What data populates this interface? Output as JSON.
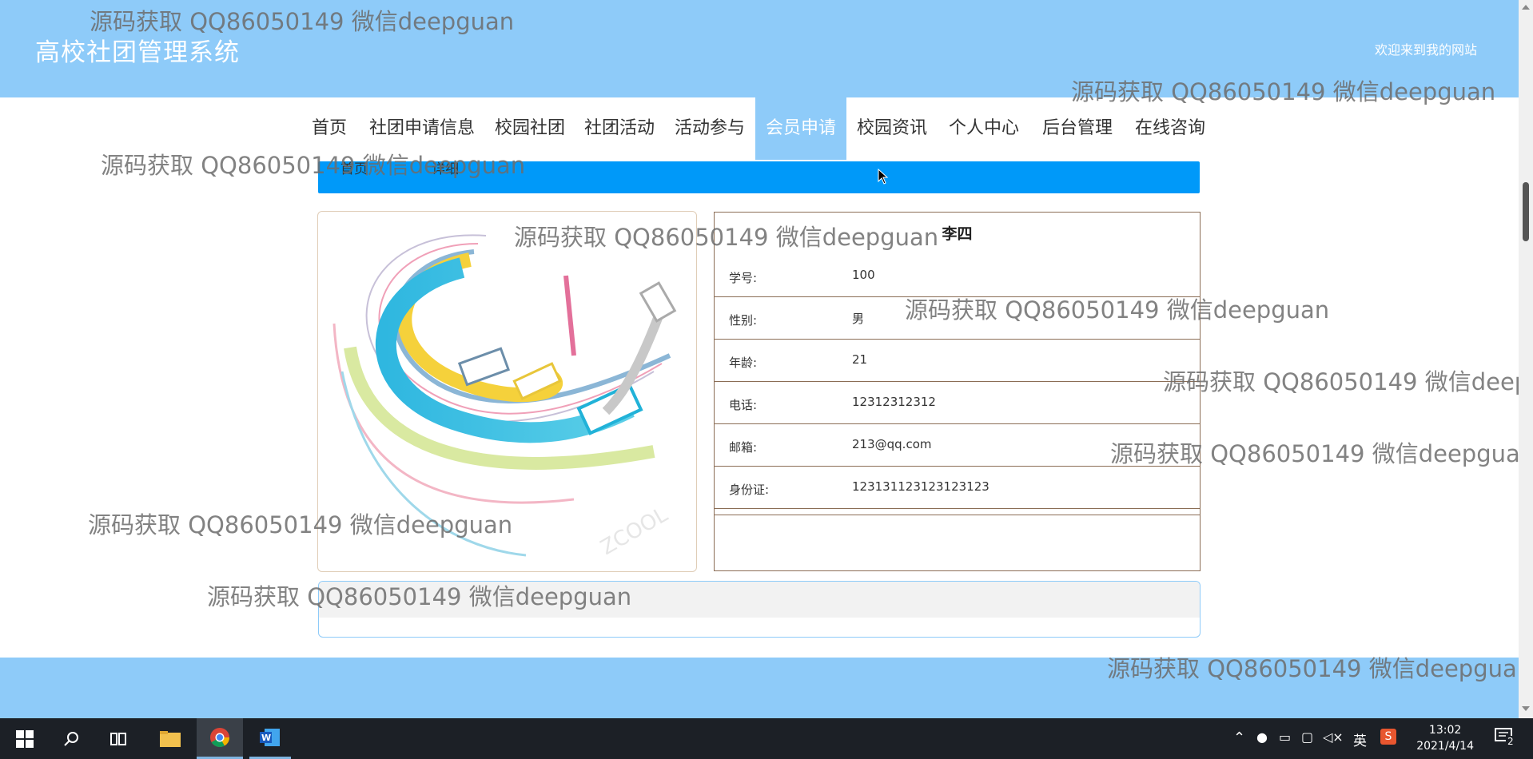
{
  "header": {
    "site_title": "高校社团管理系统",
    "welcome": "欢迎来到我的网站"
  },
  "nav": {
    "items": [
      "首页",
      "社团申请信息",
      "校园社团",
      "社团活动",
      "活动参与",
      "会员申请",
      "校园资讯",
      "个人中心",
      "后台管理",
      "在线咨询"
    ],
    "active": "会员申请"
  },
  "breadcrumb": {
    "home": "首页",
    "current": "详细"
  },
  "member": {
    "name": "李四",
    "fields": [
      {
        "label": "学号:",
        "value": "100"
      },
      {
        "label": "性别:",
        "value": "男"
      },
      {
        "label": "年龄:",
        "value": "21"
      },
      {
        "label": "电话:",
        "value": "12312312312"
      },
      {
        "label": "邮箱:",
        "value": "213@qq.com"
      },
      {
        "label": "身份证:",
        "value": "123131123123123123"
      }
    ]
  },
  "watermark": "源码获取 QQ86050149 微信deepguan",
  "taskbar": {
    "time": "13:02",
    "date": "2021/4/14",
    "ime": "英",
    "notification_count": "2"
  },
  "colors": {
    "header_bg": "#8ecbf9",
    "breadcrumb_bg": "#0099f9",
    "border": "#8b6d55"
  }
}
